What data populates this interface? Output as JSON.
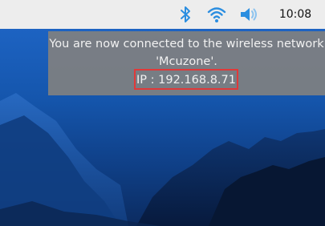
{
  "taskbar": {
    "clock": "10:08",
    "icons": [
      "bluetooth-icon",
      "wifi-icon",
      "volume-icon"
    ],
    "accent_color": "#2b8ee0"
  },
  "notification": {
    "line1": "You are now connected to the wireless network",
    "line2": "'Mcuzone'.",
    "ip": "IP : 192.168.8.71",
    "highlight_color": "#e0393a"
  }
}
